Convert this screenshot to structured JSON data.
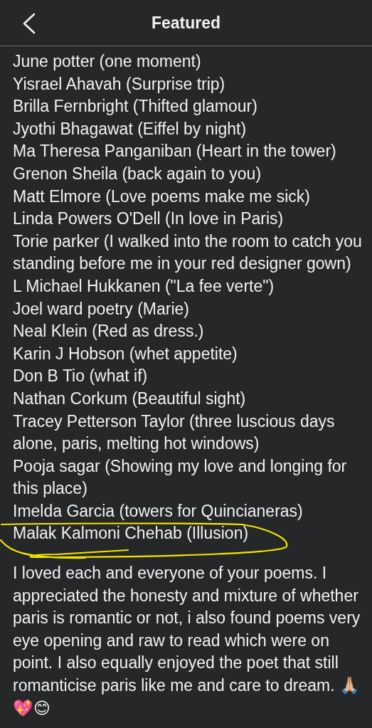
{
  "header": {
    "back_icon": true,
    "title": "Featured"
  },
  "entries": [
    {
      "text": "June potter (one moment)",
      "highlighted": false
    },
    {
      "text": "Yisrael Ahavah (Surprise trip)",
      "highlighted": false
    },
    {
      "text": "Brilla Fernbright (Thifted glamour)",
      "highlighted": false
    },
    {
      "text": "Jyothi Bhagawat (Eiffel by night)",
      "highlighted": false
    },
    {
      "text": "Ma Theresa Panganiban (Heart in the tower)",
      "highlighted": false
    },
    {
      "text": "Grenon Sheila (back again to you)",
      "highlighted": false
    },
    {
      "text": "Matt Elmore (Love poems make me sick)",
      "highlighted": false
    },
    {
      "text": "Linda Powers O'Dell (In love in Paris)",
      "highlighted": false
    },
    {
      "text": "Torie parker (I walked into the room to catch you standing before me in your red designer gown)",
      "highlighted": false
    },
    {
      "text": "L Michael Hukkanen (\"La fee verte\")",
      "highlighted": false
    },
    {
      "text": "Joel ward poetry (Marie)",
      "highlighted": false
    },
    {
      "text": "Neal Klein (Red as dress.)",
      "highlighted": false
    },
    {
      "text": "Karin J Hobson (whet appetite)",
      "highlighted": false
    },
    {
      "text": "Don B Tio (what if)",
      "highlighted": false
    },
    {
      "text": "Nathan Corkum (Beautiful sight)",
      "highlighted": false
    },
    {
      "text": "Tracey Petterson Taylor (three luscious days alone, paris, melting hot windows)",
      "highlighted": false
    },
    {
      "text": "Pooja sagar (Showing my love and longing for this place)",
      "highlighted": false
    },
    {
      "text": "Imelda Garcia (towers for Quincianeras)",
      "highlighted": false
    },
    {
      "text": "Malak Kalmoni Chehab (Illusion)",
      "highlighted": true
    }
  ],
  "comment": "I loved each and everyone of your poems. I appreciated the honesty and mixture of whether paris is romantic or not, i also found poems very eye opening and raw to read which were on point. I also equally enjoyed the poet that still romanticise paris like me and care to dream. 🙏🏼💖😊"
}
